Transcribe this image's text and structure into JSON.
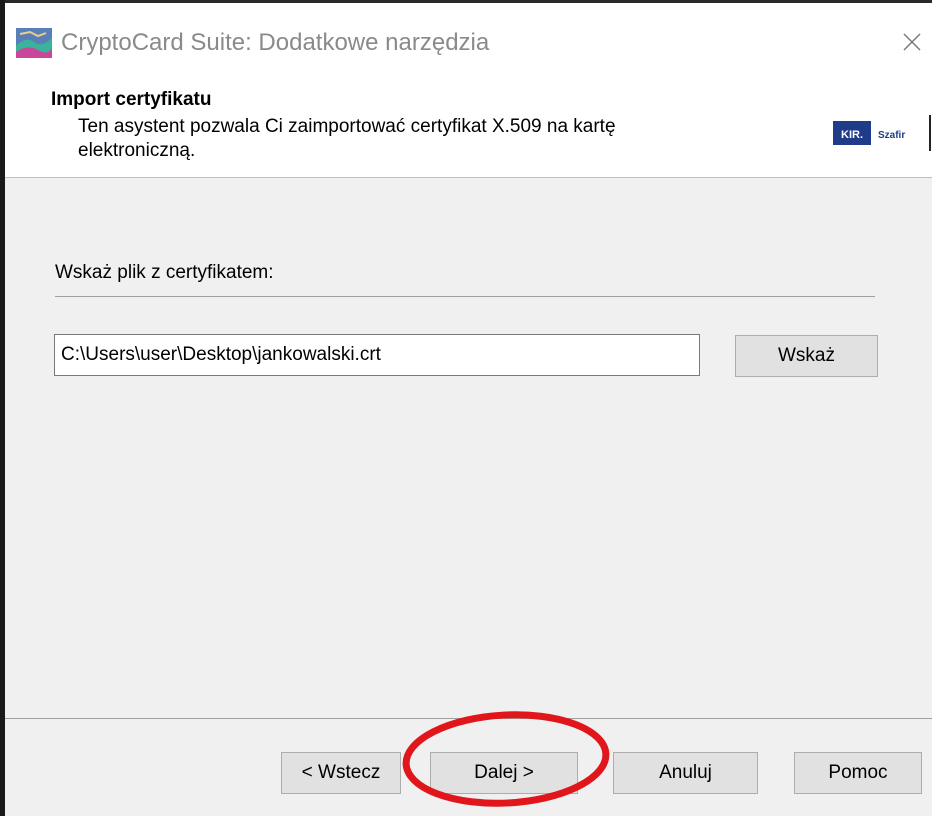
{
  "window": {
    "title": "CryptoCard Suite: Dodatkowe narzędzia",
    "close_icon": "close-icon",
    "app_icon": "cryptocard-app-icon"
  },
  "header": {
    "title": "Import certyfikatu",
    "description": "Ten asystent pozwala Ci zaimportować certyfikat X.509 na kartę elektroniczną.",
    "logo_text_left": "KIR.",
    "logo_text_right": "Szafir"
  },
  "form": {
    "label": "Wskaż plik z certyfikatem:",
    "path_value": "C:\\Users\\user\\Desktop\\jankowalski.crt",
    "browse_label": "Wskaż"
  },
  "footer": {
    "back_label": "< Wstecz",
    "next_label": "Dalej >",
    "cancel_label": "Anuluj",
    "help_label": "Pomoc"
  },
  "colors": {
    "panel_bg": "#f0f0f0",
    "button_bg": "#e1e1e1",
    "annotation_red": "#e0161b",
    "logo_blue": "#1f3c88"
  }
}
